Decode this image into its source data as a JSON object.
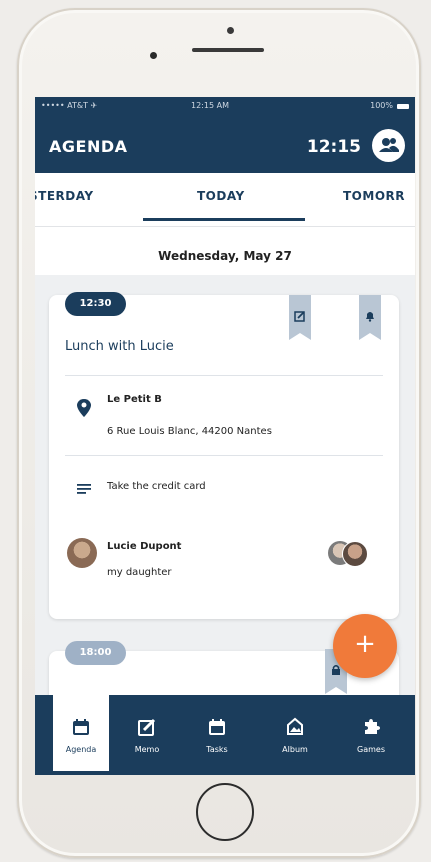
{
  "status_bar": {
    "carrier": "••••• AT&T ✈",
    "time": "12:15 AM",
    "battery": "100%"
  },
  "header": {
    "title": "AGENDA",
    "clock": "12:15"
  },
  "days": {
    "previous": "STERDAY",
    "current": "TODAY",
    "next": "TOMORR"
  },
  "date": "Wednesday, May 27",
  "events": [
    {
      "time": "12:30",
      "title": "Lunch with Lucie",
      "location_name": "Le Petit B",
      "location_address": "6 Rue Louis Blanc, 44200 Nantes",
      "note": "Take the credit card",
      "contact_name": "Lucie Dupont",
      "contact_relation": "my daughter"
    },
    {
      "time": "18:00"
    }
  ],
  "fab": {
    "label": "+"
  },
  "tabs": [
    {
      "label": "Agenda",
      "icon": "calendar-icon",
      "active": true
    },
    {
      "label": "Memo",
      "icon": "edit-icon"
    },
    {
      "label": "Tasks",
      "icon": "date-icon"
    },
    {
      "label": "Album",
      "icon": "photo-icon"
    },
    {
      "label": "Games",
      "icon": "puzzle-icon"
    }
  ],
  "colors": {
    "primary": "#1b3d5c",
    "accent": "#f07a3a",
    "background": "#eef0f2"
  }
}
